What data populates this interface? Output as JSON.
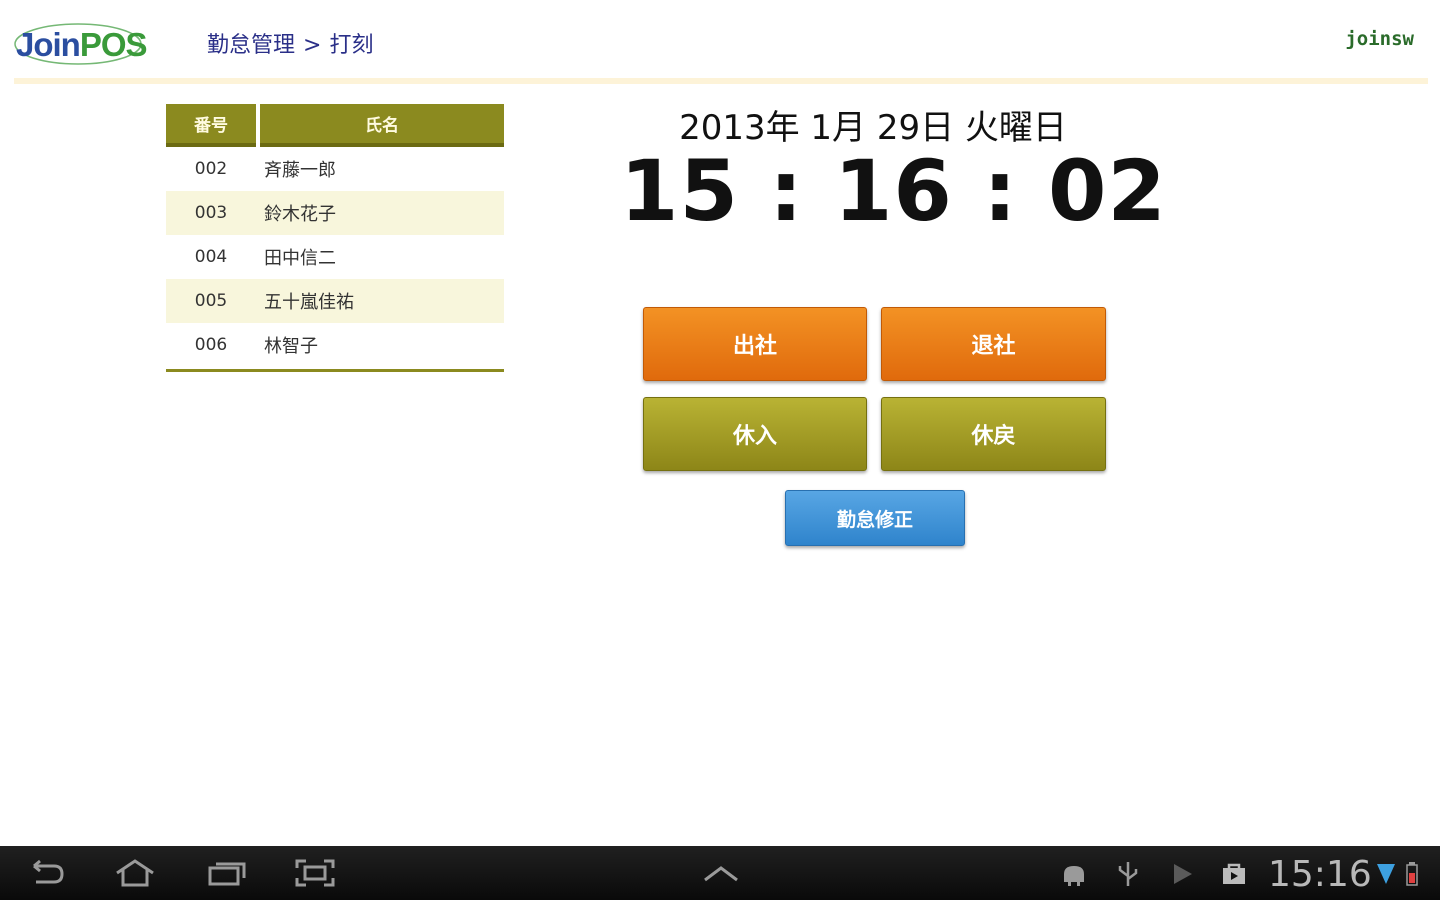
{
  "header": {
    "logo": {
      "part1": "Join",
      "part2": "POS"
    },
    "breadcrumb": {
      "section": "勤怠管理",
      "separator": ">",
      "page": "打刻"
    },
    "user": "joinsw"
  },
  "employees": {
    "columns": {
      "number": "番号",
      "name": "氏名"
    },
    "rows": [
      {
        "number": "002",
        "name": "斉藤一郎"
      },
      {
        "number": "003",
        "name": "鈴木花子"
      },
      {
        "number": "004",
        "name": "田中信二"
      },
      {
        "number": "005",
        "name": "五十嵐佳祐"
      },
      {
        "number": "006",
        "name": "林智子"
      }
    ]
  },
  "clock": {
    "date": "2013年 1月 29日 火曜日",
    "time": "15 : 16 : 02"
  },
  "actions": {
    "clock_in": "出社",
    "clock_out": "退社",
    "break_start": "休入",
    "break_end": "休戻",
    "attendance_edit": "勤怠修正"
  },
  "colors": {
    "orange": "#e8780f",
    "olive": "#8b8a1f",
    "blue": "#3a8fd4",
    "breadcrumb": "#2a2f88"
  },
  "system_bar": {
    "icons": [
      "back-icon",
      "home-icon",
      "recent-apps-icon",
      "screenshot-icon",
      "chevron-up-icon",
      "android-debug-icon",
      "usb-icon",
      "play-icon",
      "shop-icon",
      "wifi-icon",
      "battery-icon"
    ],
    "time": "15:16"
  }
}
